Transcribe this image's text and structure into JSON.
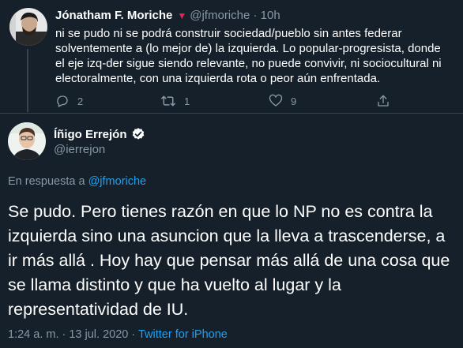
{
  "parent_tweet": {
    "author_name": "Jónatham F. Moriche",
    "flag_glyph": "▼",
    "handle": "@jfmoriche",
    "separator": "·",
    "time": "10h",
    "text": "ni se pudo ni se podrá construir sociedad/pueblo sin antes federar solventemente a (lo mejor de) la izquierda. Lo popular-progresista, donde el eje izq-der sigue siendo relevante, no puede convivir, ni sociocultural ni electoralmente, con una izquierda rota o peor aún enfrentada.",
    "reply_count": "2",
    "retweet_count": "1",
    "like_count": "9"
  },
  "main_tweet": {
    "author_name": "Íñigo Errejón",
    "verified": true,
    "handle": "@ierrejon",
    "reply_prefix": "En respuesta a",
    "reply_handle": "@jfmoriche",
    "text": "Se pudo. Pero tienes razón en que lo NP no es contra la izquierda sino una asuncion que la lleva a trascenderse, a ir más allá . Hoy hay que pensar más allá de una cosa que se llama distinto y que ha vuelto al lugar y la representatividad de IU.",
    "timestamp": "1:24 a. m. · 13 jul. 2020",
    "meta_separator": "·",
    "source": "Twitter for iPhone"
  },
  "colors": {
    "background": "#15202b",
    "text": "#ffffff",
    "muted": "#8899a6",
    "link": "#1da1f2",
    "divider": "#38444d"
  },
  "icons": [
    "reply-icon",
    "retweet-icon",
    "like-icon",
    "share-icon",
    "verified-badge-icon"
  ]
}
